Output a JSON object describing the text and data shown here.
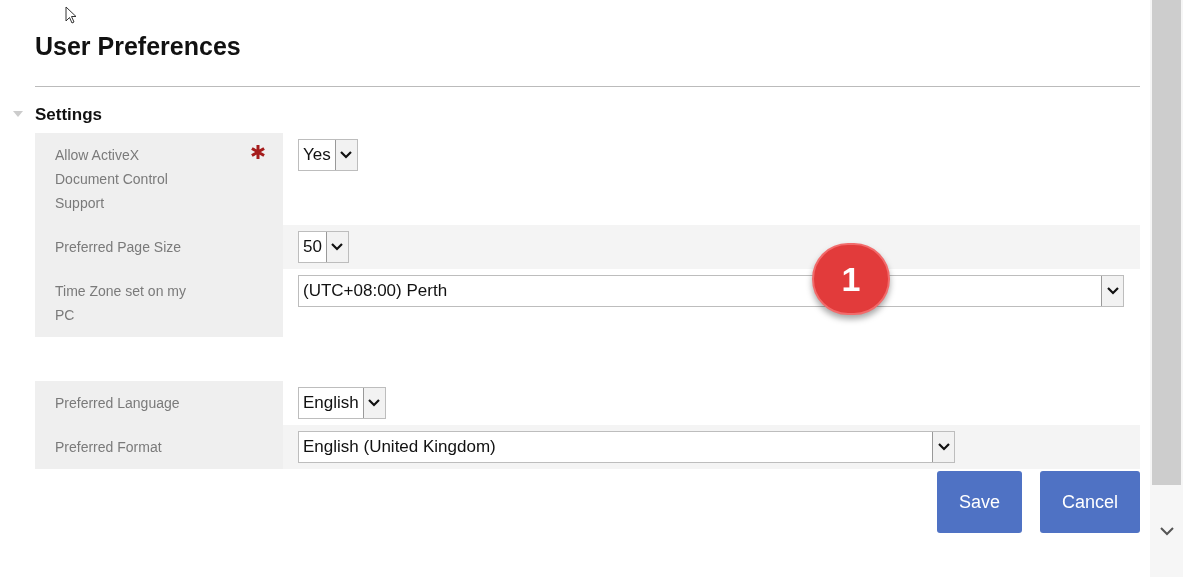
{
  "title": "User Preferences",
  "section": {
    "title": "Settings",
    "expanded": true
  },
  "groups": [
    [
      {
        "label": "Allow ActiveX Document Control Support",
        "required": true,
        "value": "Yes",
        "kind": "compact"
      },
      {
        "label": "Preferred Page Size",
        "required": false,
        "value": "50",
        "kind": "compact"
      },
      {
        "label": "Time Zone set on my PC",
        "required": false,
        "value": "(UTC+08:00) Perth",
        "kind": "full"
      }
    ],
    [
      {
        "label": "Preferred Language",
        "required": false,
        "value": "English",
        "kind": "compact"
      },
      {
        "label": "Preferred Format",
        "required": false,
        "value": "English (United Kingdom)",
        "kind": "wide"
      }
    ]
  ],
  "callout": "1",
  "buttons": [
    "Save",
    "Cancel"
  ]
}
